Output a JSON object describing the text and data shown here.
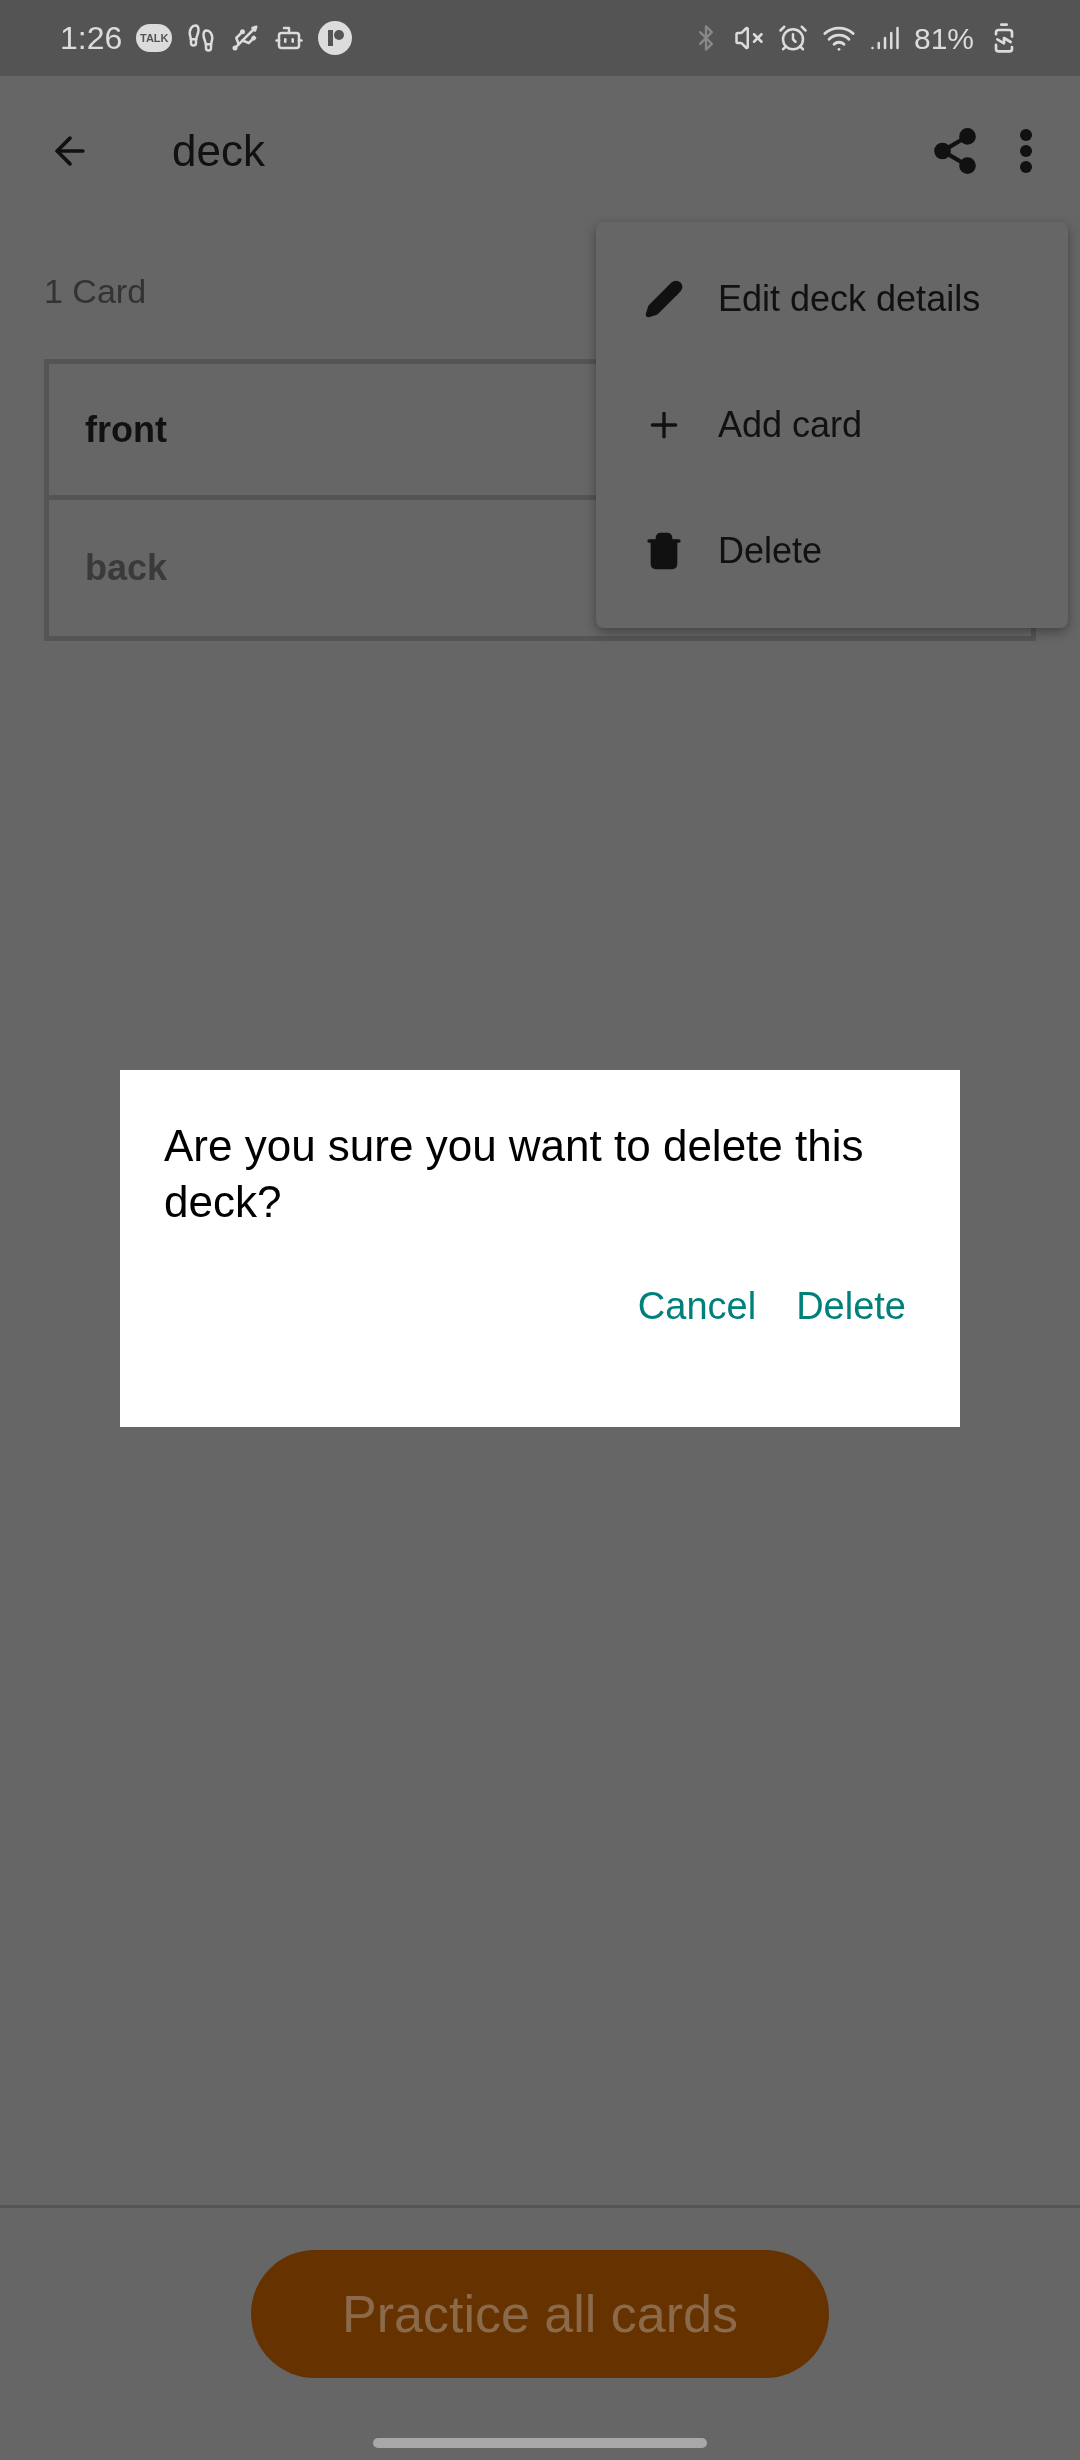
{
  "status_bar": {
    "time": "1:26",
    "talk_label": "TALK",
    "battery": "81%"
  },
  "app_bar": {
    "title": "deck"
  },
  "card_count": "1 Card",
  "card": {
    "front": "front",
    "back": "back"
  },
  "menu": [
    {
      "kind": "edit",
      "label": "Edit deck details"
    },
    {
      "kind": "add",
      "label": "Add card"
    },
    {
      "kind": "delete",
      "label": "Delete"
    }
  ],
  "dialog": {
    "message": "Are you sure you want to delete this deck?",
    "buttons": [
      "Cancel",
      "Delete"
    ]
  },
  "practice_button": "Practice all cards"
}
